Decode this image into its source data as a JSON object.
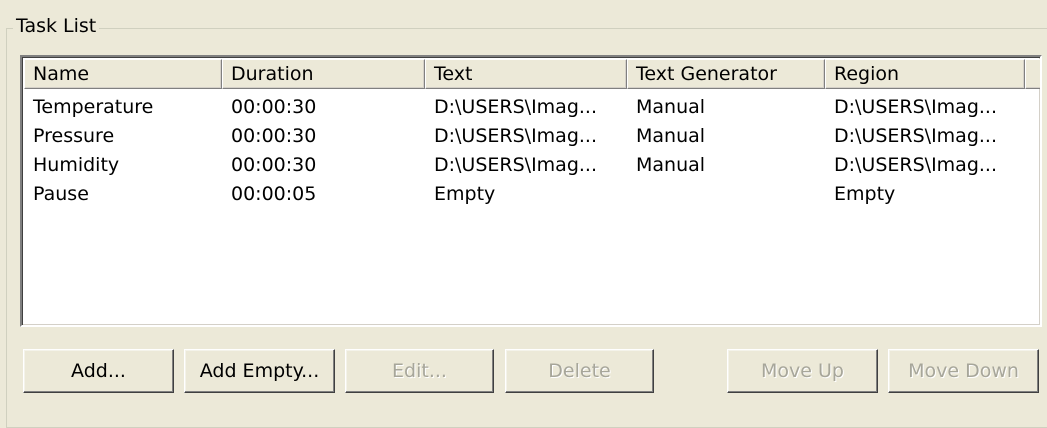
{
  "group": {
    "title": "Task List"
  },
  "columns": [
    "Name",
    "Duration",
    "Text",
    "Text Generator",
    "Region"
  ],
  "rows": [
    {
      "name": "Temperature",
      "duration": "00:00:30",
      "text": "D:\\USERS\\Imag...",
      "generator": "Manual",
      "region": "D:\\USERS\\Imag..."
    },
    {
      "name": "Pressure",
      "duration": "00:00:30",
      "text": "D:\\USERS\\Imag...",
      "generator": "Manual",
      "region": "D:\\USERS\\Imag..."
    },
    {
      "name": "Humidity",
      "duration": "00:00:30",
      "text": "D:\\USERS\\Imag...",
      "generator": "Manual",
      "region": "D:\\USERS\\Imag..."
    },
    {
      "name": "Pause",
      "duration": "00:00:05",
      "text": "Empty",
      "generator": "",
      "region": "Empty"
    }
  ],
  "buttons": {
    "add": "Add...",
    "add_empty": "Add Empty...",
    "edit": "Edit...",
    "delete": "Delete",
    "move_up": "Move Up",
    "move_down": "Move Down"
  },
  "colors": {
    "dialog_bg": "#ECE9D8",
    "list_bg": "#FFFFFF",
    "disabled_text": "#A7A69A"
  }
}
